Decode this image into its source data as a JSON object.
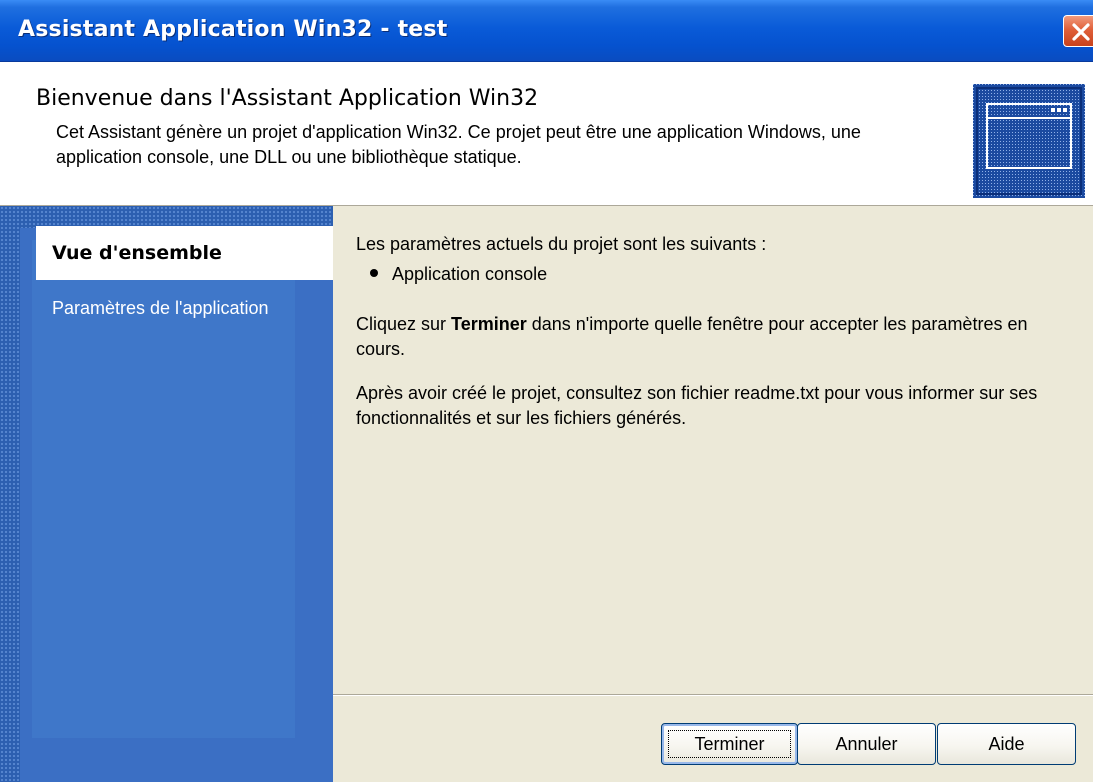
{
  "window": {
    "title": "Assistant Application Win32 - test"
  },
  "header": {
    "title": "Bienvenue dans l'Assistant Application Win32",
    "description": "Cet Assistant génère un projet d'application Win32. Ce projet peut être une application Windows, une application console, une DLL ou une bibliothèque statique.",
    "icon": "window-icon"
  },
  "sidebar": {
    "items": [
      {
        "label": "Vue d'ensemble",
        "selected": true
      },
      {
        "label": "Paramètres de l'application",
        "selected": false
      }
    ]
  },
  "content": {
    "intro": "Les paramètres actuels du projet sont les suivants :",
    "settings": [
      "Application console"
    ],
    "finish_prefix": "Cliquez sur ",
    "finish_bold": "Terminer",
    "finish_suffix": " dans n'importe quelle fenêtre pour accepter les paramètres en cours.",
    "readme": "Après avoir créé le projet, consultez son fichier readme.txt pour vous informer sur ses fonctionnalités et sur les fichiers générés."
  },
  "buttons": {
    "finish": "Terminer",
    "cancel": "Annuler",
    "help": "Aide"
  },
  "colors": {
    "titlebar": "#0a5bd8",
    "sidebar": "#2c5fb0",
    "close_button": "#e0603a"
  }
}
